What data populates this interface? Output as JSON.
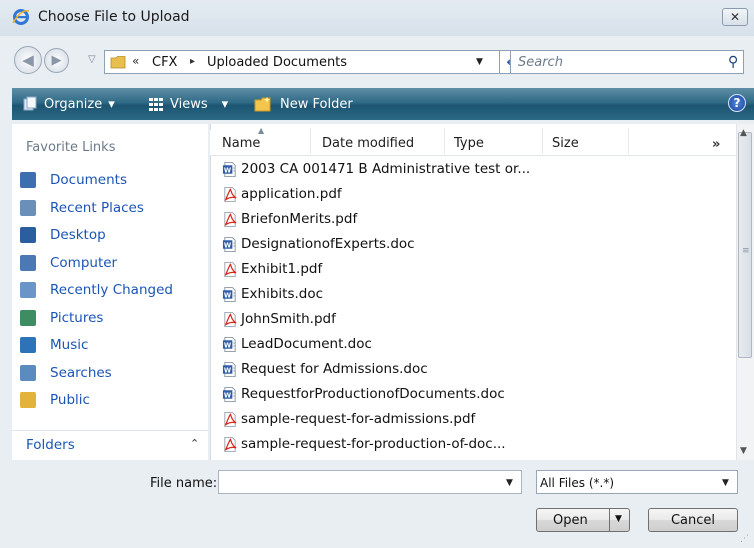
{
  "window": {
    "title": "Choose File to Upload",
    "close_glyph": "✕"
  },
  "navigation": {
    "back_glyph": "◀",
    "forward_glyph": "▶",
    "dropdown_glyph": "▽",
    "chevrons": "«",
    "crumb_separator": "▸",
    "breadcrumbs": [
      "CFX",
      "Uploaded Documents"
    ],
    "address_drop_glyph": "▼",
    "refresh_glyph": "↮"
  },
  "search": {
    "placeholder": "Search",
    "icon_glyph": "⚲"
  },
  "toolbar": {
    "organize_label": "Organize",
    "views_label": "Views",
    "new_folder_label": "New Folder",
    "caret": "▾",
    "help_glyph": "?"
  },
  "sidebar": {
    "favorite_heading": "Favorite Links",
    "items": [
      {
        "label": "Documents",
        "icon": "documents-icon",
        "color": "#3d6fb0"
      },
      {
        "label": "Recent Places",
        "icon": "recent-places-icon",
        "color": "#6a8fb8"
      },
      {
        "label": "Desktop",
        "icon": "desktop-icon",
        "color": "#2a5e9e"
      },
      {
        "label": "Computer",
        "icon": "computer-icon",
        "color": "#4a79b3"
      },
      {
        "label": "Recently Changed",
        "icon": "recently-changed-icon",
        "color": "#6a95c8"
      },
      {
        "label": "Pictures",
        "icon": "pictures-icon",
        "color": "#3e8c62"
      },
      {
        "label": "Music",
        "icon": "music-icon",
        "color": "#2c73b8"
      },
      {
        "label": "Searches",
        "icon": "searches-icon",
        "color": "#5a8cc0"
      },
      {
        "label": "Public",
        "icon": "public-icon",
        "color": "#e2b23a"
      }
    ],
    "folders_label": "Folders",
    "folders_caret": "⌃"
  },
  "columns": {
    "name": "Name",
    "date_modified": "Date modified",
    "type": "Type",
    "size": "Size",
    "more": "»",
    "sort_arrow": "▲"
  },
  "files": [
    {
      "name": "2003 CA 001471 B Administrative test or...",
      "kind": "doc"
    },
    {
      "name": "application.pdf",
      "kind": "pdf"
    },
    {
      "name": "BriefonMerits.pdf",
      "kind": "pdf"
    },
    {
      "name": "DesignationofExperts.doc",
      "kind": "doc"
    },
    {
      "name": "Exhibit1.pdf",
      "kind": "pdf"
    },
    {
      "name": "Exhibits.doc",
      "kind": "doc"
    },
    {
      "name": "JohnSmith.pdf",
      "kind": "pdf"
    },
    {
      "name": "LeadDocument.doc",
      "kind": "doc"
    },
    {
      "name": "Request for Admissions.doc",
      "kind": "doc"
    },
    {
      "name": "RequestforProductionofDocuments.doc",
      "kind": "doc"
    },
    {
      "name": "sample-request-for-admissions.pdf",
      "kind": "pdf"
    },
    {
      "name": "sample-request-for-production-of-doc...",
      "kind": "pdf"
    }
  ],
  "scrollbar": {
    "up_glyph": "▲",
    "down_glyph": "▼",
    "grip_glyph": "≡"
  },
  "bottom": {
    "file_name_label": "File name:",
    "file_name_value": "",
    "drop_glyph": "▼",
    "file_type_value": "All Files (*.*)",
    "open_label": "Open",
    "cancel_label": "Cancel",
    "resize_glyph": "⋰"
  }
}
